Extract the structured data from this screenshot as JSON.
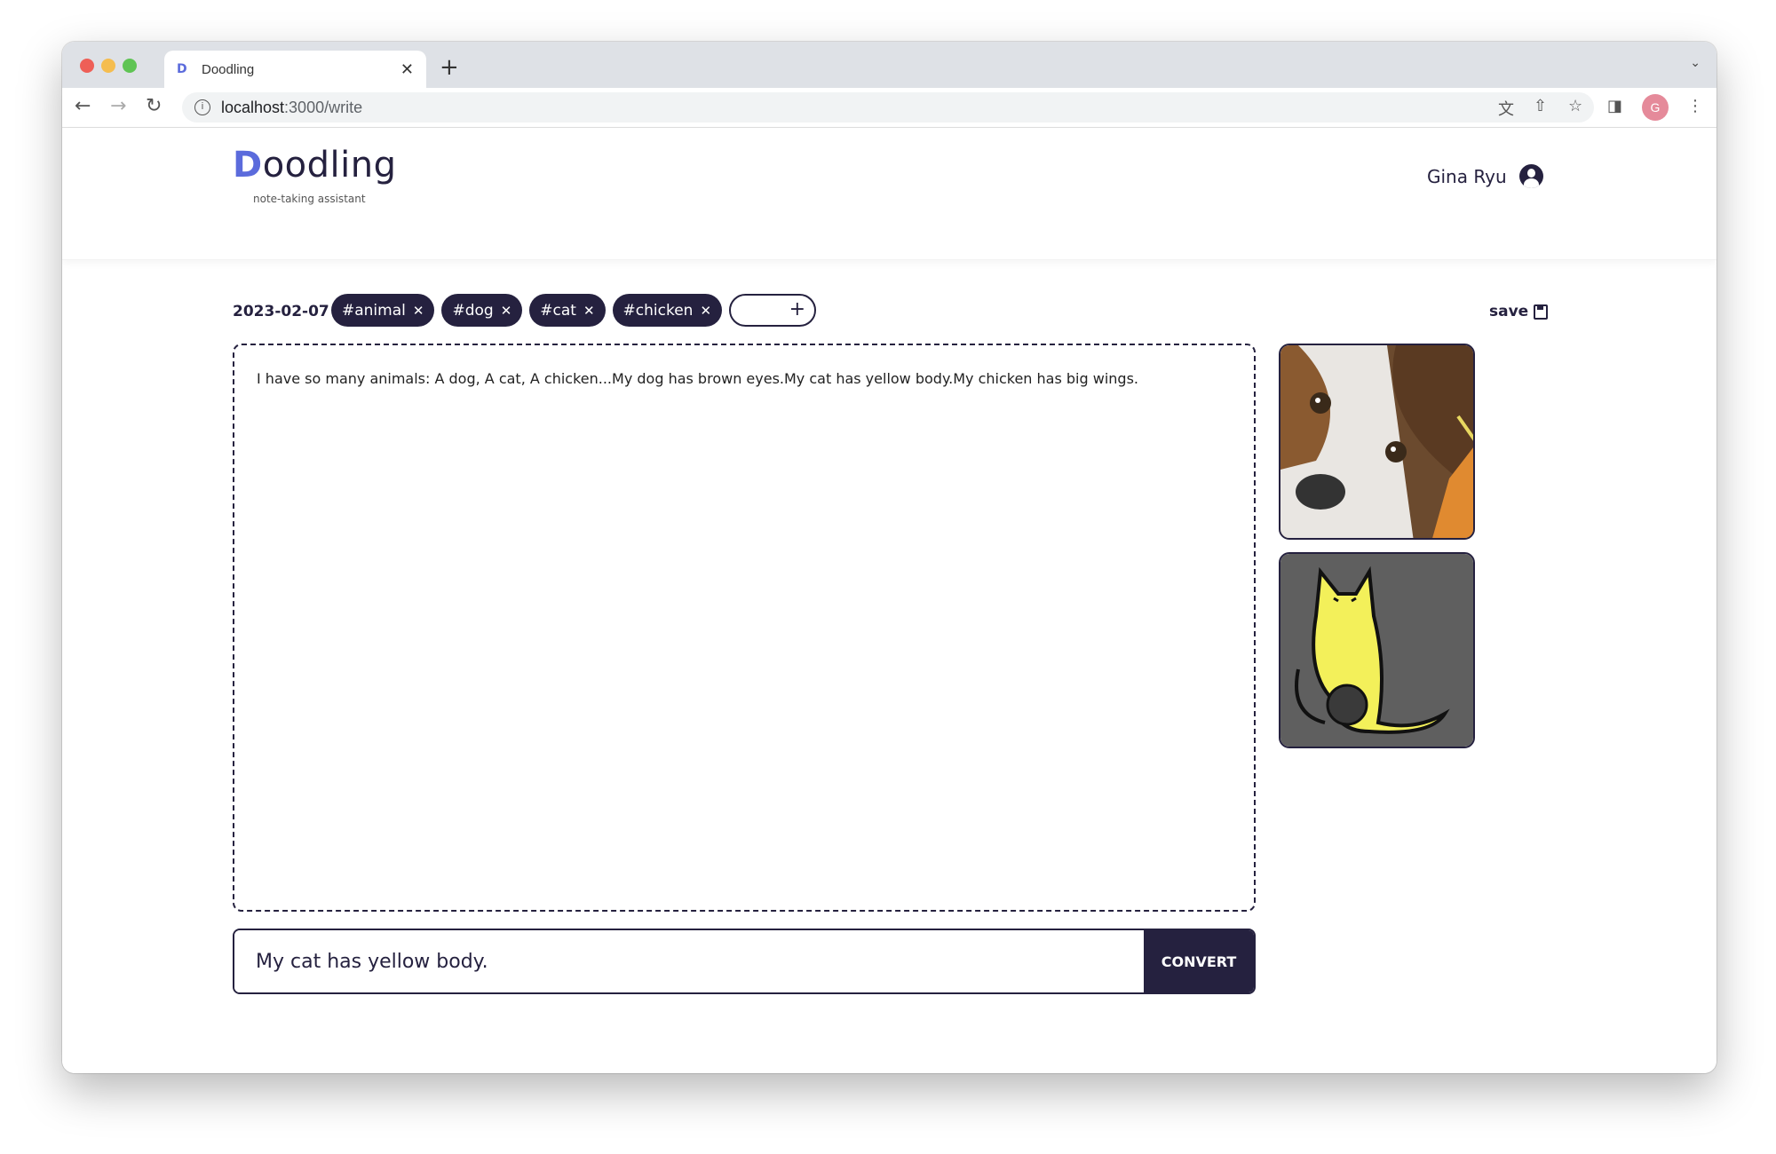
{
  "browser": {
    "tab_title": "Doodling",
    "tab_favicon": "D",
    "url_host": "localhost",
    "url_path": ":3000/write",
    "profile_initial": "G"
  },
  "header": {
    "logo_first": "D",
    "logo_rest": "oodling",
    "tagline": "note-taking assistant",
    "user_name": "Gina Ryu"
  },
  "toolbar": {
    "date": "2023-02-07",
    "tags": [
      "#animal",
      "#dog",
      "#cat",
      "#chicken"
    ],
    "add_tag_label": "+",
    "save_label": "save"
  },
  "editor": {
    "content": "I have so many animals: A dog, A cat, A chicken...My dog has brown eyes.My cat has yellow body.My chicken has big wings."
  },
  "prompt": {
    "value": "My cat has yellow body.",
    "convert_label": "CONVERT"
  },
  "colors": {
    "primary": "#25213f",
    "logo_accent": "#5b6bdc"
  }
}
